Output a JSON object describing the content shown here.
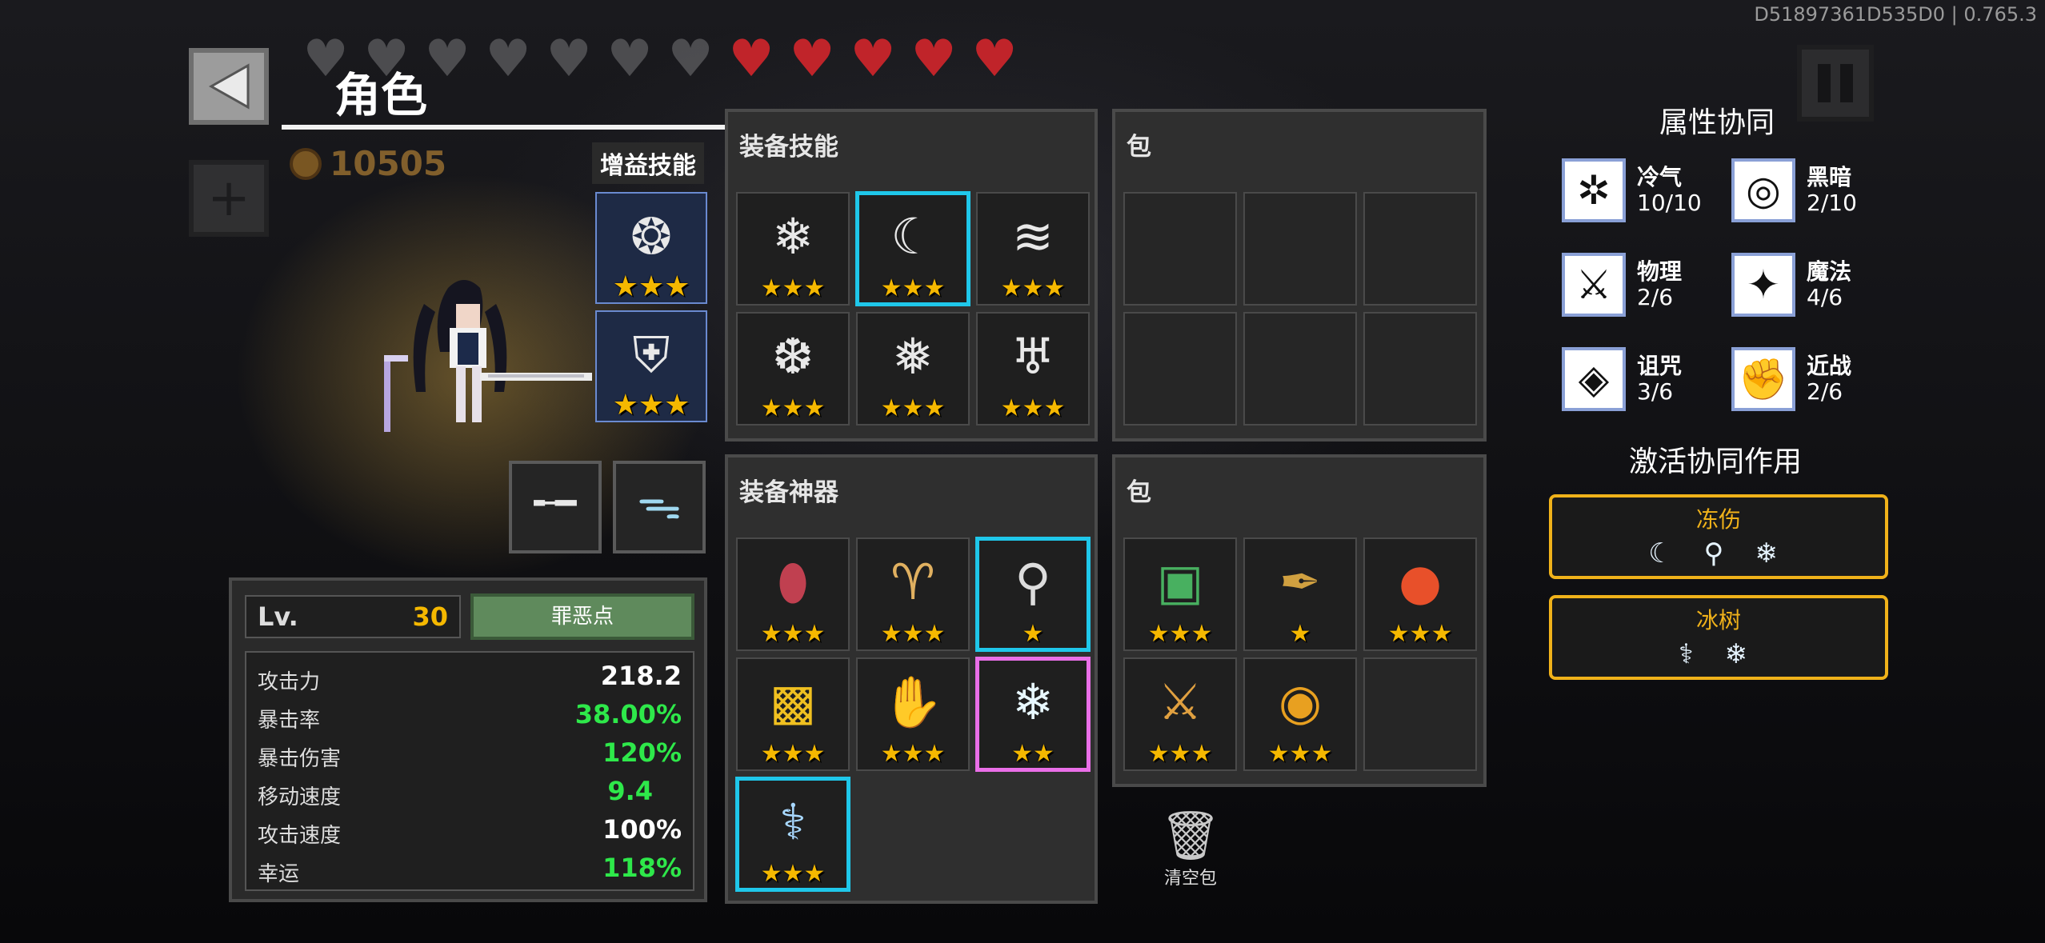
{
  "version": "D51897361D535D0 | 0.765.3",
  "header": {
    "title": "角色",
    "coins": "10505",
    "hearts_total": 12,
    "hearts_empty": 7,
    "hearts_full": 5,
    "heart_color": "#c0242a"
  },
  "buff": {
    "label": "增益技能",
    "slots": [
      {
        "icon": "swirl-icon",
        "glyph": "❂",
        "stars": "★★★"
      },
      {
        "icon": "shield-emblem-icon",
        "glyph": "⛨",
        "stars": "★★★"
      }
    ]
  },
  "equip_items": [
    {
      "icon": "gun-icon",
      "glyph": "╾━"
    },
    {
      "icon": "jellyfish-icon",
      "glyph": "ᯓ"
    }
  ],
  "stats_panel": {
    "lv_label": "Lv.",
    "lv_value": "30",
    "evil_button": "罪恶点",
    "rows": [
      {
        "label": "攻击力",
        "value": "218.2",
        "color": "#ffffff"
      },
      {
        "label": "暴击率",
        "value": "38.00%",
        "color": "#2ee84a"
      },
      {
        "label": "暴击伤害",
        "value": "120%",
        "color": "#2ee84a"
      },
      {
        "label": "移动速度",
        "value": "9.4",
        "color": "#2ee84a"
      },
      {
        "label": "攻击速度",
        "value": "100%",
        "color": "#ffffff"
      },
      {
        "label": "幸运",
        "value": "118%",
        "color": "#2ee84a"
      }
    ]
  },
  "equip_skills": {
    "title": "装备技能",
    "slots": [
      {
        "icon": "frost-sword-icon",
        "glyph": "❄",
        "stars": "★★★"
      },
      {
        "icon": "crescent-slash-icon",
        "glyph": "☾",
        "stars": "★★★",
        "frame": "cyan"
      },
      {
        "icon": "wind-slash-icon",
        "glyph": "≋",
        "stars": "★★★"
      },
      {
        "icon": "snowflake-orb-icon",
        "glyph": "❆",
        "stars": "★★★"
      },
      {
        "icon": "frost-blade-icon",
        "glyph": "❅",
        "stars": "★★★"
      },
      {
        "icon": "wing-skull-icon",
        "glyph": "♅",
        "stars": "★★★"
      }
    ]
  },
  "skill_bag": {
    "title": "包"
  },
  "equip_artifacts": {
    "title": "装备神器",
    "slots": [
      {
        "icon": "red-egg-icon",
        "glyph": "⬮",
        "stars": "★★★",
        "color": "#c04050"
      },
      {
        "icon": "golden-goat-icon",
        "glyph": "♈",
        "stars": "★★★",
        "color": "#e0b060"
      },
      {
        "icon": "racket-icon",
        "glyph": "⚲",
        "stars": "★",
        "frame": "cyan",
        "color": "#dddddd"
      },
      {
        "icon": "gold-cube-icon",
        "glyph": "▩",
        "stars": "★★★",
        "color": "#f0c020"
      },
      {
        "icon": "dark-gauntlet-icon",
        "glyph": "✋",
        "stars": "★★★",
        "color": "#4a3060"
      },
      {
        "icon": "ice-crystal-icon",
        "glyph": "❄",
        "stars": "★★",
        "frame": "pink",
        "color": "#e8f8ff"
      },
      {
        "icon": "ice-branch-icon",
        "glyph": "⚕",
        "stars": "★★★",
        "frame": "cyan",
        "color": "#a8d8ff"
      }
    ]
  },
  "artifact_bag": {
    "title": "包",
    "slots": [
      {
        "icon": "green-box-icon",
        "glyph": "▣",
        "stars": "★★★",
        "color": "#48b060"
      },
      {
        "icon": "pen-icon",
        "glyph": "✒",
        "stars": "★",
        "color": "#d0a040"
      },
      {
        "icon": "fire-orb-icon",
        "glyph": "●",
        "stars": "★★★",
        "color": "#e8502a"
      },
      {
        "icon": "golden-sword-icon",
        "glyph": "⚔",
        "stars": "★★★",
        "color": "#e0a040"
      },
      {
        "icon": "gold-coin-icon",
        "glyph": "◉",
        "stars": "★★★",
        "color": "#e8a020"
      }
    ]
  },
  "trash": {
    "label": "清空包"
  },
  "synergy": {
    "title": "属性协同",
    "items": [
      {
        "name": "冷气",
        "value": "10/10",
        "icon": "snowflake-icon",
        "glyph": "✲"
      },
      {
        "name": "黑暗",
        "value": "2/10",
        "icon": "dark-eye-icon",
        "glyph": "◎"
      },
      {
        "name": "物理",
        "value": "2/6",
        "icon": "sword-icon",
        "glyph": "⚔"
      },
      {
        "name": "魔法",
        "value": "4/6",
        "icon": "magic-star-icon",
        "glyph": "✦"
      },
      {
        "name": "诅咒",
        "value": "3/6",
        "icon": "curse-eye-icon",
        "glyph": "◈"
      },
      {
        "name": "近战",
        "value": "2/6",
        "icon": "fist-icon",
        "glyph": "✊"
      }
    ],
    "active_title": "激活协同作用",
    "active": [
      {
        "name": "冻伤",
        "icons": "☾ ⚲ ❄"
      },
      {
        "name": "冰树",
        "icons": "⚕ ❄"
      }
    ]
  }
}
